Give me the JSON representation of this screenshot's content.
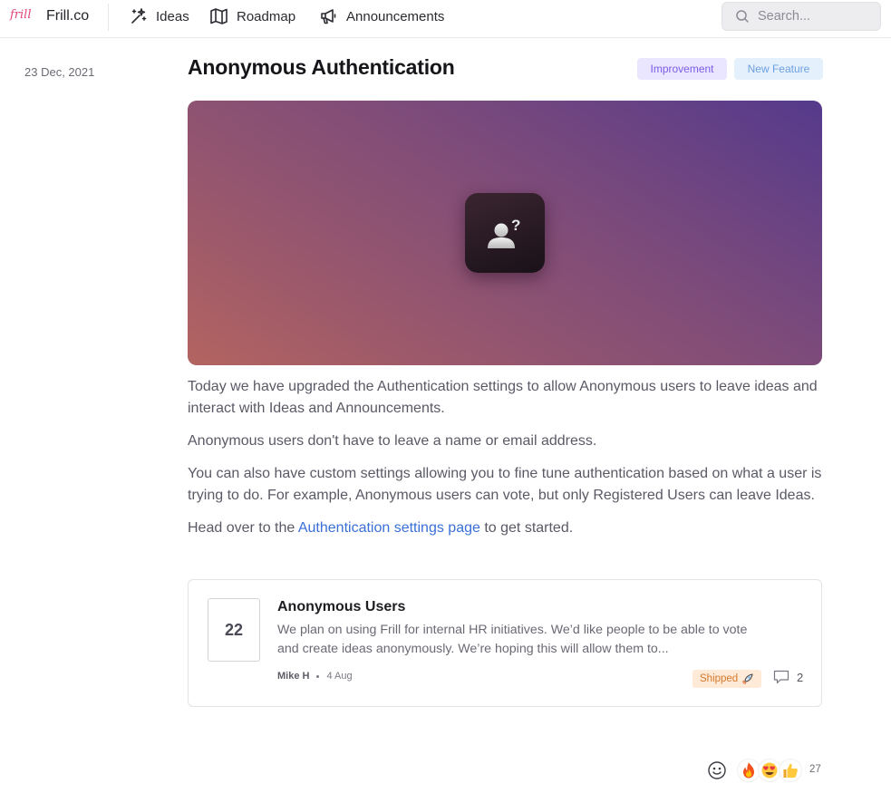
{
  "nav": {
    "logo_text": "frill",
    "brand": "Frill.co",
    "items": [
      {
        "label": "Ideas",
        "icon": "sparkles-icon"
      },
      {
        "label": "Roadmap",
        "icon": "map-icon"
      },
      {
        "label": "Announcements",
        "icon": "megaphone-icon"
      }
    ],
    "search_placeholder": "Search..."
  },
  "post": {
    "date": "23 Dec, 2021",
    "title": "Anonymous Authentication",
    "tags": [
      {
        "label": "Improvement",
        "color": "#7a5ce6"
      },
      {
        "label": "New Feature",
        "color": "#6d9fe0"
      }
    ],
    "hero_icon": "anonymous-user-icon",
    "body": {
      "p1": "Today we have upgraded the Authentication settings to allow Anonymous users to leave ideas and interact with Ideas and Announcements.",
      "p2": "Anonymous users don't have to leave a name or email address.",
      "p3": "You can also have custom settings allowing you to fine tune authentication based on what a user is trying to do. For example, Anonymous users can vote, but only Registered Users can leave Ideas.",
      "p4_before": "Head over to the ",
      "p4_link": "Authentication settings page",
      "p4_after": " to get started."
    }
  },
  "idea": {
    "votes": "22",
    "title": "Anonymous Users",
    "description": "We plan on using Frill for internal HR initiatives. We’d like people to be able to vote and create ideas anonymously. We’re hoping this will allow them to...",
    "author": "Mike H",
    "date": "4 Aug",
    "status": "Shipped",
    "status_icon": "rocket-icon",
    "comment_count": "2"
  },
  "reactions": {
    "emojis": [
      "🔥",
      "😍",
      "👍"
    ],
    "count": "27"
  },
  "colors": {
    "accent_link": "#3a6fd8",
    "logo": "#e0457b",
    "shipped": "#d57a2c"
  }
}
